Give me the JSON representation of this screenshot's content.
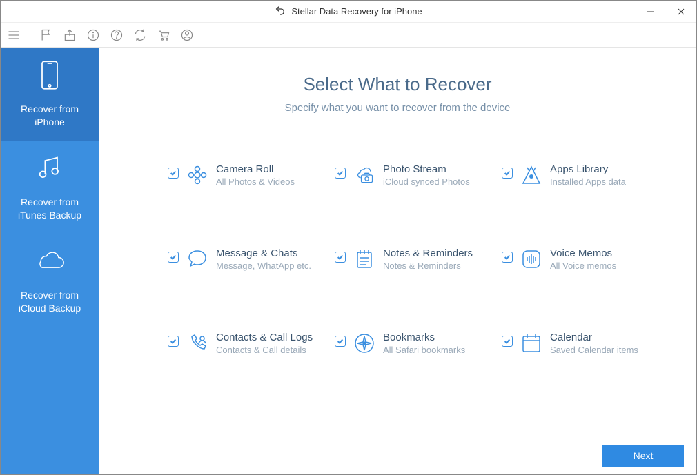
{
  "window": {
    "title": "Stellar Data Recovery for iPhone"
  },
  "sidebar": {
    "items": [
      {
        "label": "Recover from\niPhone",
        "icon": "phone-icon",
        "active": true
      },
      {
        "label": "Recover from\niTunes Backup",
        "icon": "music-note-icon",
        "active": false
      },
      {
        "label": "Recover from\niCloud Backup",
        "icon": "cloud-icon",
        "active": false
      }
    ]
  },
  "header": {
    "title": "Select What to Recover",
    "subtitle": "Specify what you want to recover from the device"
  },
  "categories": [
    {
      "title": "Camera Roll",
      "desc": "All Photos & Videos",
      "icon": "camera-roll-icon",
      "checked": true
    },
    {
      "title": "Photo Stream",
      "desc": "iCloud synced Photos",
      "icon": "photo-stream-icon",
      "checked": true
    },
    {
      "title": "Apps Library",
      "desc": "Installed Apps data",
      "icon": "apps-icon",
      "checked": true
    },
    {
      "title": "Message & Chats",
      "desc": "Message, WhatApp etc.",
      "icon": "message-icon",
      "checked": true
    },
    {
      "title": "Notes & Reminders",
      "desc": "Notes & Reminders",
      "icon": "notes-icon",
      "checked": true
    },
    {
      "title": "Voice Memos",
      "desc": "All Voice memos",
      "icon": "voice-icon",
      "checked": true
    },
    {
      "title": "Contacts & Call Logs",
      "desc": "Contacts & Call details",
      "icon": "contacts-icon",
      "checked": true
    },
    {
      "title": "Bookmarks",
      "desc": "All Safari bookmarks",
      "icon": "bookmarks-icon",
      "checked": true
    },
    {
      "title": "Calendar",
      "desc": "Saved Calendar items",
      "icon": "calendar-icon",
      "checked": true
    }
  ],
  "footer": {
    "next_label": "Next"
  }
}
